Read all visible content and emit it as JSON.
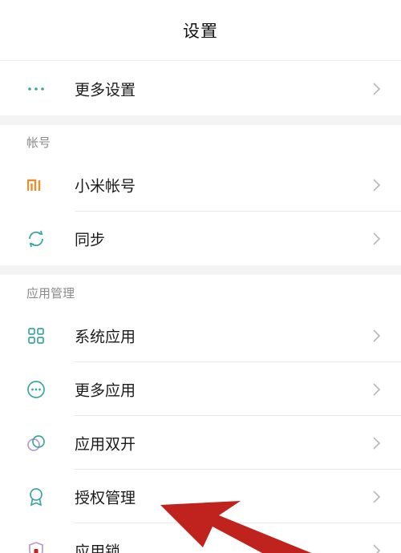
{
  "header": {
    "title": "设置"
  },
  "rows_top": [
    {
      "label": "更多设置",
      "icon": "more-dots-icon"
    }
  ],
  "account_section": {
    "title": "帐号",
    "items": [
      {
        "label": "小米帐号",
        "icon": "mi-logo-icon"
      },
      {
        "label": "同步",
        "icon": "sync-icon"
      }
    ]
  },
  "apps_section": {
    "title": "应用管理",
    "items": [
      {
        "label": "系统应用",
        "icon": "grid-apps-icon"
      },
      {
        "label": "更多应用",
        "icon": "more-circle-icon"
      },
      {
        "label": "应用双开",
        "icon": "dual-circle-icon"
      },
      {
        "label": "授权管理",
        "icon": "badge-icon"
      },
      {
        "label": "应用锁",
        "icon": "shield-lock-icon"
      }
    ]
  },
  "colors": {
    "teal": "#3aa6a0",
    "mi_orange": "#e8902f",
    "purple": "#b49ad0",
    "arrow_red": "#c0221e"
  }
}
